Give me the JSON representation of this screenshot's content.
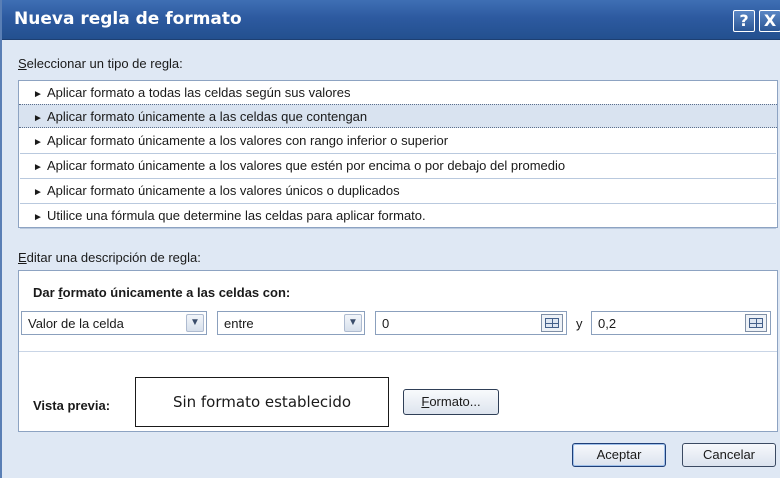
{
  "window": {
    "title": "Nueva regla de formato",
    "help_glyph": "?",
    "close_glyph": "X"
  },
  "rule_type": {
    "label_prefix": "S",
    "label_rest": "eleccionar un tipo de regla:",
    "arrow_glyph": "►",
    "items": [
      {
        "label": "Aplicar formato a todas las celdas según sus valores"
      },
      {
        "label": "Aplicar formato únicamente a las celdas que contengan",
        "selected": true
      },
      {
        "label": "Aplicar formato únicamente a los valores con rango inferior o superior"
      },
      {
        "label": "Aplicar formato únicamente a los valores que estén por encima o por debajo del promedio"
      },
      {
        "label": "Aplicar formato únicamente a los valores únicos o duplicados"
      },
      {
        "label": "Utilice una fórmula que determine las celdas para aplicar formato."
      }
    ]
  },
  "description": {
    "label_prefix": "E",
    "label_rest": "ditar una descripción de regla:",
    "heading_pre": "Dar ",
    "heading_u": "f",
    "heading_post": "ormato únicamente a las celdas con:",
    "condition_type": "Valor de la celda",
    "operator": "entre",
    "value1": "0",
    "and_label": "y",
    "value2": "0,2",
    "dropdown_glyph": "▼"
  },
  "preview": {
    "label": "Vista previa:",
    "text": "Sin formato establecido",
    "format_button_u": "F",
    "format_button_rest": "ormato..."
  },
  "footer": {
    "ok_label": "Aceptar",
    "cancel_label": "Cancelar"
  }
}
